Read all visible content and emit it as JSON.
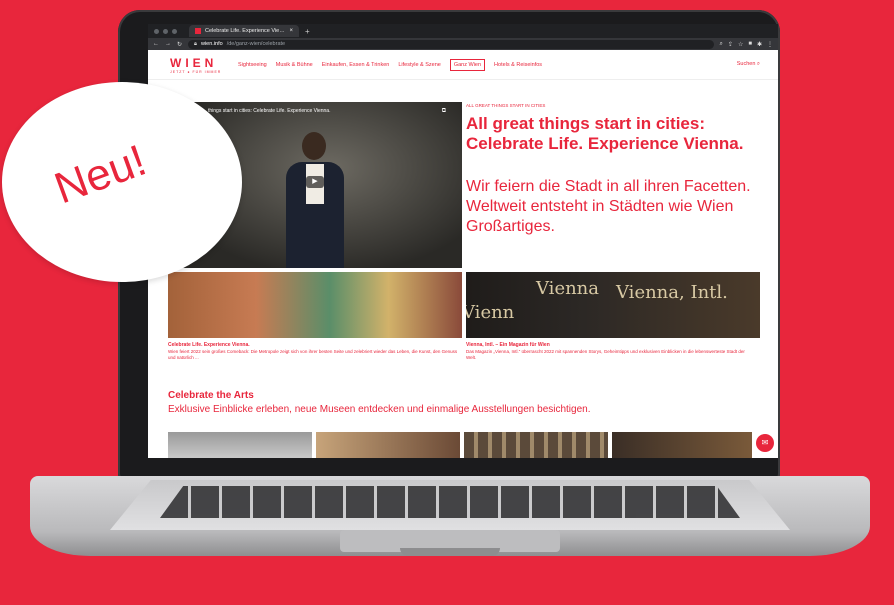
{
  "browser": {
    "tab_title": "Celebrate Life. Experience Vie…",
    "url_host": "wien.info",
    "url_path": "/de/ganz-wien/celebrate"
  },
  "site": {
    "logo_main": "WIEN",
    "logo_sub": "JETZT ● FÜR IMMER",
    "nav": [
      "Sightseeing",
      "Musik & Bühne",
      "Einkaufen, Essen & Trinken",
      "Lifestyle & Szene",
      "Ganz Wien",
      "Hotels & Reiseinfos"
    ],
    "search_label": "Suchen"
  },
  "hero": {
    "video_title": "things start in cities: Celebrate Life. Experience Vienna.",
    "eyebrow": "ALL GREAT THINGS START IN CITIES",
    "title": "All great things start in cities: Celebrate Life. Experience Vienna.",
    "subtitle": "Wir feiern die Stadt in all ihren Facetten. Weltweit entsteht in Städten wie Wien Großartiges."
  },
  "cards": [
    {
      "title": "Celebrate Life. Experience Vienna.",
      "text": "Wien feiert 2022 sein großes Comeback: Die Metropole zeigt sich von ihrer besten Seite und zelebriert wieder das Leben, die Kunst, den Genuss und natürlich ..."
    },
    {
      "title": "Vienna, Intl. – Ein Magazin für Wien",
      "text": "Das Magazin „Vienna, Intl.“ überrascht 2022 mit spannenden Storys, Geheimtipps und exklusiven Einblicken in die lebenswerteste Stadt der Welt."
    }
  ],
  "magazine_words": [
    "Vienn",
    "Vienna",
    "Vienna, Intl."
  ],
  "section": {
    "title": "Celebrate the Arts",
    "subtitle": "Exklusive Einblicke erleben, neue Museen entdecken und einmalige Ausstellungen besichtigen."
  },
  "badge": {
    "text": "Neu!"
  }
}
